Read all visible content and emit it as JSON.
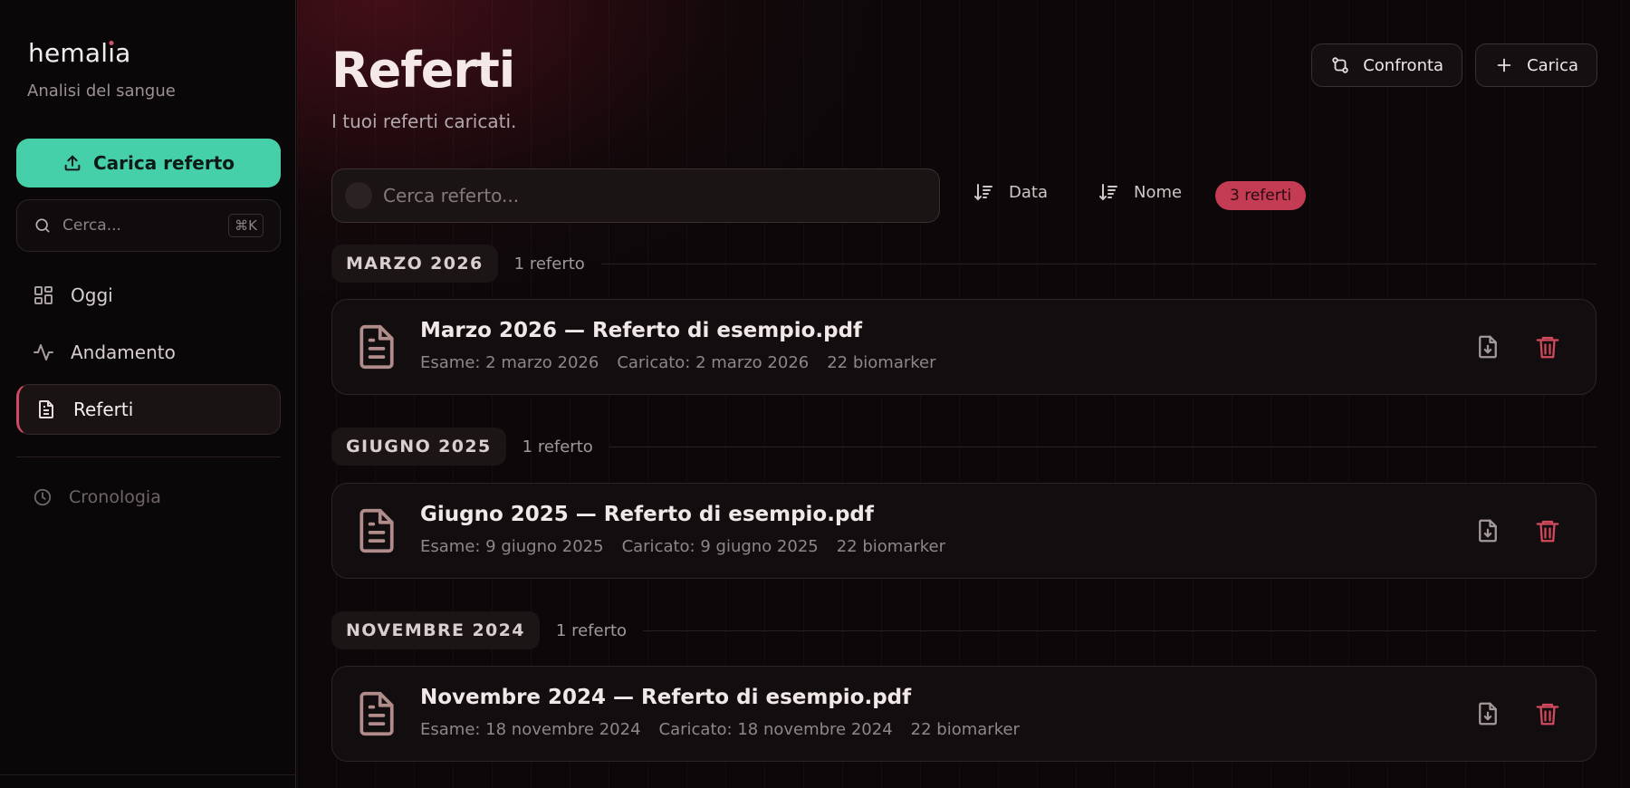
{
  "sidebar": {
    "logo": "hemalia",
    "subtitle": "Analisi del sangue",
    "upload_label": "Carica referto",
    "search_placeholder": "Cerca...",
    "search_shortcut": "⌘K",
    "nav": [
      {
        "label": "Oggi",
        "icon": "grid-icon"
      },
      {
        "label": "Andamento",
        "icon": "activity-icon"
      },
      {
        "label": "Referti",
        "icon": "file-icon",
        "active": true
      }
    ],
    "history_label": "Cronologia"
  },
  "header": {
    "title": "Referti",
    "subtitle": "I tuoi referti caricati.",
    "compare_label": "Confronta",
    "upload_label": "Carica"
  },
  "toolbar": {
    "search_placeholder": "Cerca referto...",
    "sort_date_label": "Data",
    "sort_name_label": "Nome",
    "count_label": "3 referti"
  },
  "groups": [
    {
      "label": "MARZO 2026",
      "count": "1 referto",
      "report": {
        "title": "Marzo 2026 — Referto di esempio.pdf",
        "exam": "Esame: 2 marzo 2026",
        "uploaded": "Caricato: 2 marzo 2026",
        "biomarkers": "22 biomarker"
      }
    },
    {
      "label": "GIUGNO 2025",
      "count": "1 referto",
      "report": {
        "title": "Giugno 2025 — Referto di esempio.pdf",
        "exam": "Esame: 9 giugno 2025",
        "uploaded": "Caricato: 9 giugno 2025",
        "biomarkers": "22 biomarker"
      }
    },
    {
      "label": "NOVEMBRE 2024",
      "count": "1 referto",
      "report": {
        "title": "Novembre 2024 — Referto di esempio.pdf",
        "exam": "Esame: 18 novembre 2024",
        "uploaded": "Caricato: 18 novembre 2024",
        "biomarkers": "22 biomarker"
      }
    }
  ],
  "colors": {
    "accent": "#45d0a9",
    "brand_red": "#c33c53",
    "background": "#0c0809"
  }
}
